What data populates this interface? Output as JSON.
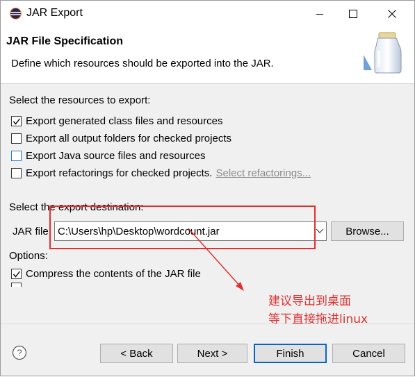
{
  "window": {
    "title": "JAR Export"
  },
  "banner": {
    "title": "JAR File Specification",
    "description": "Define which resources should be exported into the JAR."
  },
  "resources": {
    "heading": "Select the resources to export:",
    "options": [
      {
        "label": "Export generated class files and resources",
        "checked": true
      },
      {
        "label": "Export all output folders for checked projects",
        "checked": false
      },
      {
        "label": "Export Java source files and resources",
        "checked": false
      },
      {
        "label": "Export refactorings for checked projects.",
        "checked": false
      }
    ],
    "refactorings_link": "Select refactorings..."
  },
  "destination": {
    "heading": "Select the export destination:",
    "jar_label": "JAR file:",
    "jar_value": "C:\\Users\\hp\\Desktop\\wordcount.jar",
    "browse_label": "Browse..."
  },
  "options": {
    "heading": "Options:",
    "compress_label": "Compress the contents of the JAR file",
    "compress_checked": true
  },
  "footer": {
    "back_label": "< Back",
    "next_label": "Next >",
    "finish_label": "Finish",
    "cancel_label": "Cancel"
  },
  "annotation": {
    "line1": "建议导出到桌面",
    "line2": "等下直接拖进linux",
    "color": "#e03030"
  },
  "icons": {
    "help": "help-icon",
    "jar": "jar-icon",
    "app": "eclipse-icon"
  }
}
